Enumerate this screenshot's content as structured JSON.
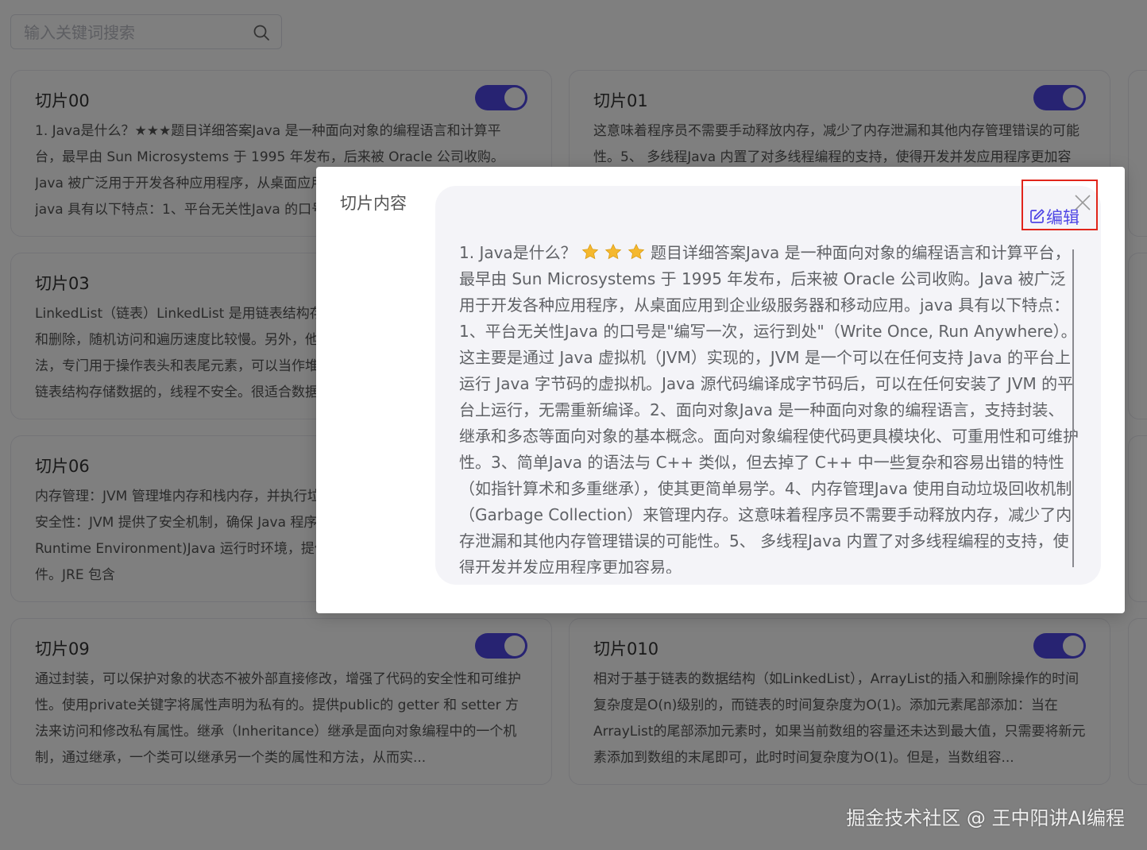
{
  "search": {
    "placeholder": "输入关键词搜索"
  },
  "cards": [
    {
      "title": "切片00",
      "text": "1. Java是什么？★★★题目详细答案Java 是一种面向对象的编程语言和计算平台，最早由 Sun Microsystems 于 1995 年发布，后来被 Oracle 公司收购。Java 被广泛用于开发各种应用程序，从桌面应用到企业级服务器和移动应用。java 具有以下特点：1、平台无关性Java 的口号是\"编写一次，运行到处\"",
      "enabled": true
    },
    {
      "title": "切片01",
      "text": "这意味着程序员不需要手动释放内存，减少了内存泄漏和其他内存管理错误的可能性。5、 多线程Java 内置了对多线程编程的支持，使得开发并发应用程序更加容易。",
      "enabled": true
    },
    {
      "title": "切片03",
      "text": "LinkedList（链表）LinkedList 是用链表结构存储数据的，很适合数据的动态插入和删除，随机访问和遍历速度比较慢。另外，他还提供了 List 接口中没有定义的方法，专门用于操作表头和表尾元素，可以当作堆栈、队列和双向队列使用。它是用链表结构存储数据的，线程不安全。很适合数据的动态插入和删除，随机访问和遍历速度比较慢，增删快。另外，他还提",
      "enabled": true
    },
    {
      "title": "切片06",
      "text": "内存管理：JVM 管理堆内存和栈内存，并执行垃圾回收（Garbage Collection）。安全性：JVM 提供了安全机制，确保 Java 程序在受控环境中运行。JRE (Java Runtime Environment)Java 运行时环境，提供运行 Java 应用程序所需的所有组件。JRE 包含",
      "enabled": true
    },
    {
      "title": "切片09",
      "text": "通过封装，可以保护对象的状态不被外部直接修改，增强了代码的安全性和可维护性。使用private关键字将属性声明为私有的。提供public的 getter 和 setter 方法来访问和修改私有属性。继承（Inheritance）继承是面向对象编程中的一个机制，通过继承，一个类可以继承另一个类的属性和方法，从而实...",
      "enabled": true
    },
    {
      "title": "切片010",
      "text": "相对于基于链表的数据结构（如LinkedList），ArrayList的插入和删除操作的时间复杂度是O(n)级别的，而链表的时间复杂度为O(1)。添加元素尾部添加：当在ArrayList的尾部添加元素时，如果当前数组的容量还未达到最大值，只需要将新元素添加到数组的末尾即可，此时时间复杂度为O(1)。但是，当数组容...",
      "enabled": true
    }
  ],
  "dialog": {
    "label": "切片内容",
    "edit_label": "编辑",
    "content_prefix": "1. Java是什么？",
    "content_body": "题目详细答案Java 是一种面向对象的编程语言和计算平台，最早由 Sun Microsystems 于 1995 年发布，后来被 Oracle 公司收购。Java 被广泛用于开发各种应用程序，从桌面应用到企业级服务器和移动应用。java 具有以下特点：1、平台无关性Java 的口号是\"编写一次，运行到处\"（Write Once, Run Anywhere）。这主要是通过 Java 虚拟机（JVM）实现的，JVM 是一个可以在任何支持 Java 的平台上运行 Java 字节码的虚拟机。Java 源代码编译成字节码后，可以在任何安装了 JVM 的平台上运行，无需重新编译。2、面向对象Java 是一种面向对象的编程语言，支持封装、继承和多态等面向对象的基本概念。面向对象编程使代码更具模块化、可重用性和可维护性。3、简单Java 的语法与 C++ 类似，但去掉了 C++ 中一些复杂和容易出错的特性（如指针算术和多重继承），使其更简单易学。4、内存管理Java 使用自动垃圾回收机制（Garbage Collection）来管理内存。这意味着程序员不需要手动释放内存，减少了内存泄漏和其他内存管理错误的可能性。5、 多线程Java 内置了对多线程编程的支持，使得开发并发应用程序更加容易。",
    "star_color": "#f5b82e"
  },
  "watermark": "掘金技术社区 @ 王中阳讲AI编程",
  "colors": {
    "accent": "#4f46e5",
    "highlight_border": "#e1251b"
  }
}
